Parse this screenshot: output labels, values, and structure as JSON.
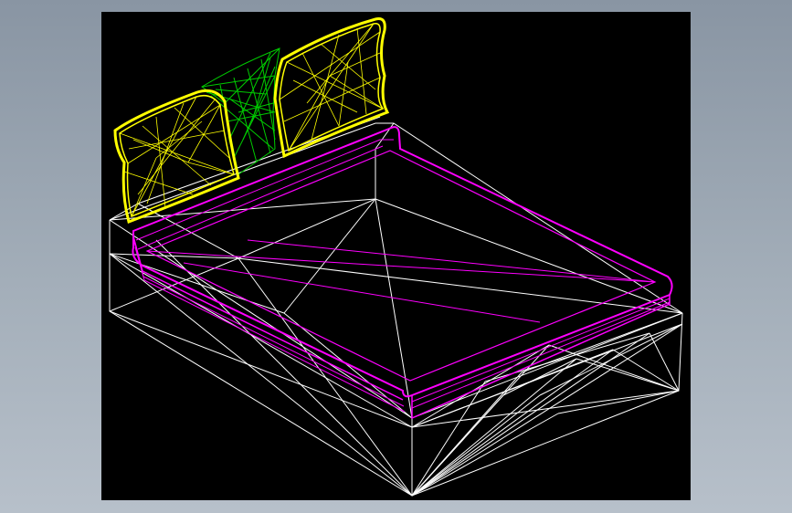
{
  "app": {
    "background_color": "#9aa5b1",
    "viewport_color": "#000000"
  },
  "model": {
    "layers": [
      {
        "name": "headboard-cushions",
        "color": "#ffff00"
      },
      {
        "name": "center-pillow",
        "color": "#00cc00"
      },
      {
        "name": "mattress",
        "color": "#ff00ff"
      },
      {
        "name": "bed-base",
        "color": "#ffffff"
      }
    ]
  }
}
